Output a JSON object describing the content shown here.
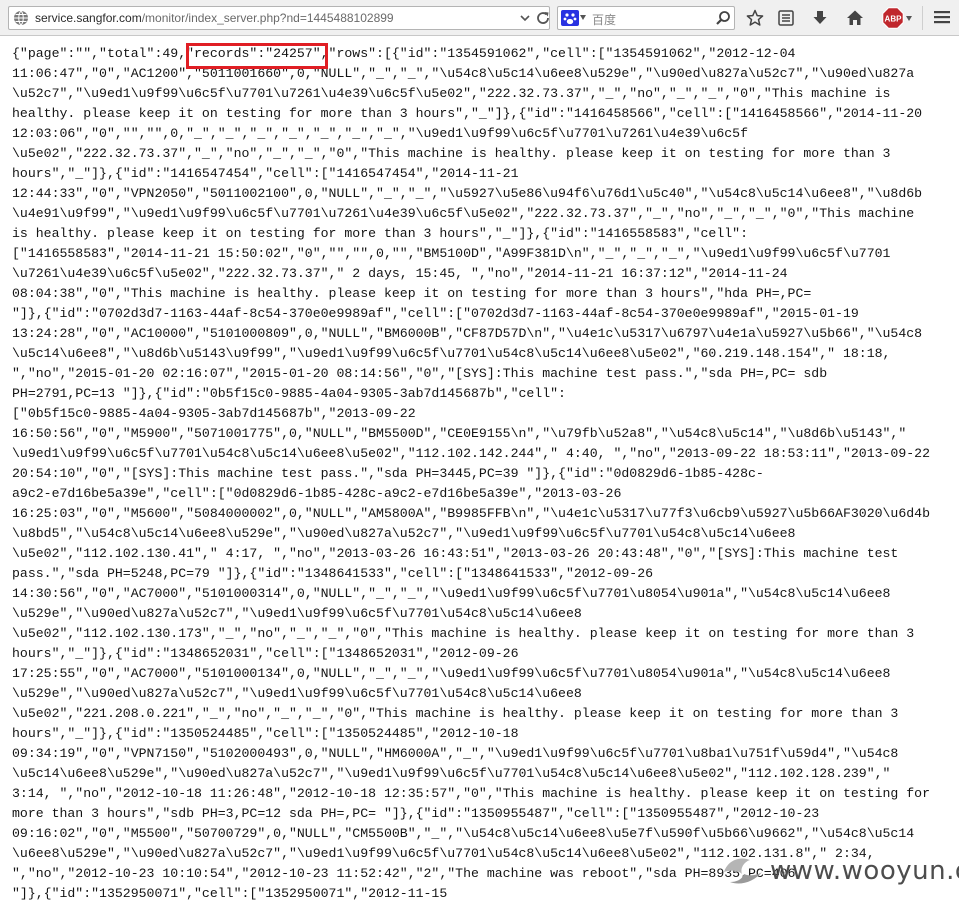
{
  "browser": {
    "url_host": "service.sangfor.com",
    "url_path": "/monitor/index_server.php?nd=1445488102899",
    "search_placeholder": "百度",
    "icons": [
      "globe-icon",
      "dropdown-icon",
      "reload-icon",
      "search-engine-icon",
      "search-icon",
      "star-icon",
      "reading-list-icon",
      "download-icon",
      "home-icon",
      "adblock-icon",
      "menu-icon"
    ],
    "adblock_label": "ABP"
  },
  "page": {
    "lines": [
      "{\"page\":\"\",\"total\":49,\"records\":\"24257\",\"rows\":[{\"id\":\"1354591062\",\"cell\":[\"1354591062\",\"2012-12-04",
      "11:06:47\",\"0\",\"AC1200\",\"5011001660\",0,\"NULL\",\"_\",\"_\",\"\\u54c8\\u5c14\\u6ee8\\u529e\",\"\\u90ed\\u827a\\u52c7\",\"\\u90ed\\u827a",
      "\\u52c7\",\"\\u9ed1\\u9f99\\u6c5f\\u7701\\u7261\\u4e39\\u6c5f\\u5e02\",\"222.32.73.37\",\"_\",\"no\",\"_\",\"_\",\"0\",\"This machine is",
      "healthy. please keep it on testing for more than 3 hours\",\"_\"]},{\"id\":\"1416458566\",\"cell\":[\"1416458566\",\"2014-11-20",
      "12:03:06\",\"0\",\"\",\"\",0,\"_\",\"_\",\"_\",\"_\",\"_\",\"_\",\"_\",\"\\u9ed1\\u9f99\\u6c5f\\u7701\\u7261\\u4e39\\u6c5f",
      "\\u5e02\",\"222.32.73.37\",\"_\",\"no\",\"_\",\"_\",\"0\",\"This machine is healthy. please keep it on testing for more than 3",
      "hours\",\"_\"]},{\"id\":\"1416547454\",\"cell\":[\"1416547454\",\"2014-11-21",
      "12:44:33\",\"0\",\"VPN2050\",\"5011002100\",0,\"NULL\",\"_\",\"_\",\"\\u5927\\u5e86\\u94f6\\u76d1\\u5c40\",\"\\u54c8\\u5c14\\u6ee8\",\"\\u8d6b",
      "\\u4e91\\u9f99\",\"\\u9ed1\\u9f99\\u6c5f\\u7701\\u7261\\u4e39\\u6c5f\\u5e02\",\"222.32.73.37\",\"_\",\"no\",\"_\",\"_\",\"0\",\"This machine",
      "is healthy. please keep it on testing for more than 3 hours\",\"_\"]},{\"id\":\"1416558583\",\"cell\":",
      "[\"1416558583\",\"2014-11-21 15:50:02\",\"0\",\"\",\"\",0,\"\",\"BM5100D\",\"A99F381D\\n\",\"_\",\"_\",\"_\",\"\\u9ed1\\u9f99\\u6c5f\\u7701",
      "\\u7261\\u4e39\\u6c5f\\u5e02\",\"222.32.73.37\",\" 2 days, 15:45, \",\"no\",\"2014-11-21 16:37:12\",\"2014-11-24",
      "08:04:38\",\"0\",\"This machine is healthy. please keep it on testing for more than 3 hours\",\"hda PH=,PC=",
      "\"]},{\"id\":\"0702d3d7-1163-44af-8c54-370e0e9989af\",\"cell\":[\"0702d3d7-1163-44af-8c54-370e0e9989af\",\"2015-01-19",
      "13:24:28\",\"0\",\"AC10000\",\"5101000809\",0,\"NULL\",\"BM6000B\",\"CF87D57D\\n\",\"\\u4e1c\\u5317\\u6797\\u4e1a\\u5927\\u5b66\",\"\\u54c8",
      "\\u5c14\\u6ee8\",\"\\u8d6b\\u5143\\u9f99\",\"\\u9ed1\\u9f99\\u6c5f\\u7701\\u54c8\\u5c14\\u6ee8\\u5e02\",\"60.219.148.154\",\" 18:18,",
      "\",\"no\",\"2015-01-20 02:16:07\",\"2015-01-20 08:14:56\",\"0\",\"[SYS]:This machine test pass.\",\"sda PH=,PC= sdb",
      "PH=2791,PC=13 \"]},{\"id\":\"0b5f15c0-9885-4a04-9305-3ab7d145687b\",\"cell\":",
      "[\"0b5f15c0-9885-4a04-9305-3ab7d145687b\",\"2013-09-22",
      "16:50:56\",\"0\",\"M5900\",\"5071001775\",0,\"NULL\",\"BM5500D\",\"CE0E9155\\n\",\"\\u79fb\\u52a8\",\"\\u54c8\\u5c14\",\"\\u8d6b\\u5143\",\"",
      "\\u9ed1\\u9f99\\u6c5f\\u7701\\u54c8\\u5c14\\u6ee8\\u5e02\",\"112.102.142.244\",\" 4:40, \",\"no\",\"2013-09-22 18:53:11\",\"2013-09-22",
      "20:54:10\",\"0\",\"[SYS]:This machine test pass.\",\"sda PH=3445,PC=39 \"]},{\"id\":\"0d0829d6-1b85-428c-",
      "a9c2-e7d16be5a39e\",\"cell\":[\"0d0829d6-1b85-428c-a9c2-e7d16be5a39e\",\"2013-03-26",
      "16:25:03\",\"0\",\"M5600\",\"5084000002\",0,\"NULL\",\"AM5800A\",\"B9985FFB\\n\",\"\\u4e1c\\u5317\\u77f3\\u6cb9\\u5927\\u5b66AF3020\\u6d4b",
      "\\u8bd5\",\"\\u54c8\\u5c14\\u6ee8\\u529e\",\"\\u90ed\\u827a\\u52c7\",\"\\u9ed1\\u9f99\\u6c5f\\u7701\\u54c8\\u5c14\\u6ee8",
      "\\u5e02\",\"112.102.130.41\",\" 4:17, \",\"no\",\"2013-03-26 16:43:51\",\"2013-03-26 20:43:48\",\"0\",\"[SYS]:This machine test",
      "pass.\",\"sda PH=5248,PC=79 \"]},{\"id\":\"1348641533\",\"cell\":[\"1348641533\",\"2012-09-26",
      "14:30:56\",\"0\",\"AC7000\",\"5101000314\",0,\"NULL\",\"_\",\"_\",\"\\u9ed1\\u9f99\\u6c5f\\u7701\\u8054\\u901a\",\"\\u54c8\\u5c14\\u6ee8",
      "\\u529e\",\"\\u90ed\\u827a\\u52c7\",\"\\u9ed1\\u9f99\\u6c5f\\u7701\\u54c8\\u5c14\\u6ee8",
      "\\u5e02\",\"112.102.130.173\",\"_\",\"no\",\"_\",\"_\",\"0\",\"This machine is healthy. please keep it on testing for more than 3",
      "hours\",\"_\"]},{\"id\":\"1348652031\",\"cell\":[\"1348652031\",\"2012-09-26",
      "17:25:55\",\"0\",\"AC7000\",\"5101000134\",0,\"NULL\",\"_\",\"_\",\"\\u9ed1\\u9f99\\u6c5f\\u7701\\u8054\\u901a\",\"\\u54c8\\u5c14\\u6ee8",
      "\\u529e\",\"\\u90ed\\u827a\\u52c7\",\"\\u9ed1\\u9f99\\u6c5f\\u7701\\u54c8\\u5c14\\u6ee8",
      "\\u5e02\",\"221.208.0.221\",\"_\",\"no\",\"_\",\"_\",\"0\",\"This machine is healthy. please keep it on testing for more than 3",
      "hours\",\"_\"]},{\"id\":\"1350524485\",\"cell\":[\"1350524485\",\"2012-10-18",
      "09:34:19\",\"0\",\"VPN7150\",\"5102000493\",0,\"NULL\",\"HM6000A\",\"_\",\"\\u9ed1\\u9f99\\u6c5f\\u7701\\u8ba1\\u751f\\u59d4\",\"\\u54c8",
      "\\u5c14\\u6ee8\\u529e\",\"\\u90ed\\u827a\\u52c7\",\"\\u9ed1\\u9f99\\u6c5f\\u7701\\u54c8\\u5c14\\u6ee8\\u5e02\",\"112.102.128.239\",\"",
      "3:14, \",\"no\",\"2012-10-18 11:26:48\",\"2012-10-18 12:35:57\",\"0\",\"This machine is healthy. please keep it on testing for",
      "more than 3 hours\",\"sdb PH=3,PC=12 sda PH=,PC= \"]},{\"id\":\"1350955487\",\"cell\":[\"1350955487\",\"2012-10-23",
      "09:16:02\",\"0\",\"M5500\",\"50700729\",0,\"NULL\",\"CM5500B\",\"_\",\"\\u54c8\\u5c14\\u6ee8\\u5e7f\\u590f\\u5b66\\u9662\",\"\\u54c8\\u5c14",
      "\\u6ee8\\u529e\",\"\\u90ed\\u827a\\u52c7\",\"\\u9ed1\\u9f99\\u6c5f\\u7701\\u54c8\\u5c14\\u6ee8\\u5e02\",\"112.102.131.8\",\" 2:34,",
      "\",\"no\",\"2012-10-23 10:10:54\",\"2012-10-23 11:52:42\",\"2\",\"The machine was reboot\",\"sda PH=8935,PC=406",
      "\"]},{\"id\":\"1352950071\",\"cell\":[\"1352950071\",\"2012-11-15"
    ]
  },
  "watermark": {
    "text": "www.wooyun.org"
  },
  "colors": {
    "highlight": "#e01e24",
    "toolbar_bg": "#f0f0f0",
    "adblock_red": "#c0272d"
  }
}
